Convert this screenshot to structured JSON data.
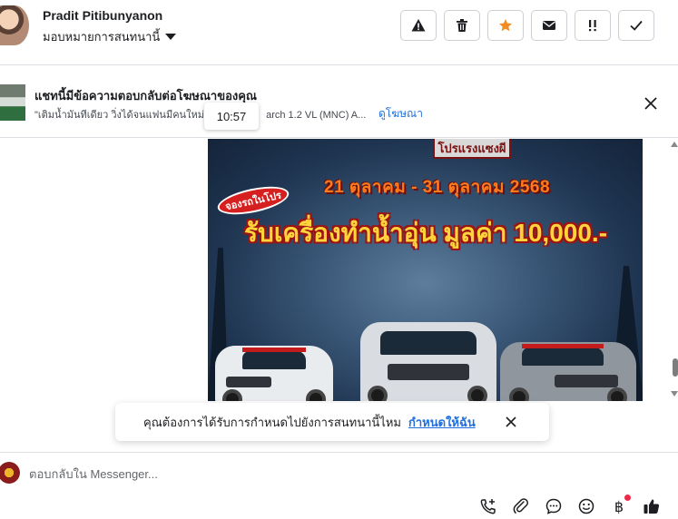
{
  "header": {
    "contact_name": "Pradit Pitibunyanon",
    "assign_label": "มอบหมายการสนทนานี้",
    "actions": [
      {
        "name": "spam-button",
        "icon": "warning-icon"
      },
      {
        "name": "delete-button",
        "icon": "trash-icon"
      },
      {
        "name": "star-button",
        "icon": "star-icon",
        "color": "#f28b22"
      },
      {
        "name": "mark-unread-button",
        "icon": "envelope-icon"
      },
      {
        "name": "follow-up-button",
        "icon": "double-exclamation-icon"
      },
      {
        "name": "mark-done-button",
        "icon": "check-icon"
      }
    ]
  },
  "ad_banner": {
    "title": "แชทนี้มีข้อความตอบกลับต่อโฆษณาของคุณ",
    "subtitle": "\"เติมน้ำมันทีเดียว วิ่งได้จนแฟนมีคนใหม่",
    "subtitle_tail": "arch 1.2 VL (MNC) A...",
    "link": "ดูโฆษณา"
  },
  "tooltip_time": "10:57",
  "image_message": {
    "promo_label": "โปรแรงแซงผี",
    "date_range": "21 ตุลาคม - 31 ตุลาคม 2568",
    "booking_tag": "จองรถในโปร",
    "headline": "รับเครื่องทำน้ำอุ่น มูลค่า 10,000.-"
  },
  "toast": {
    "text": "คุณต้องการได้รับการกำหนดไปยังการสนทนานี้ไหม",
    "link": "กำหนดให้ฉัน"
  },
  "composer": {
    "placeholder": "ตอบกลับใน Messenger...",
    "tools": [
      "add-call-icon",
      "paperclip-icon",
      "chat-bubble-icon",
      "emoji-icon",
      "baht-icon",
      "thumbs-up-icon"
    ],
    "baht_symbol": "฿",
    "accent_color": "#216fdb"
  }
}
